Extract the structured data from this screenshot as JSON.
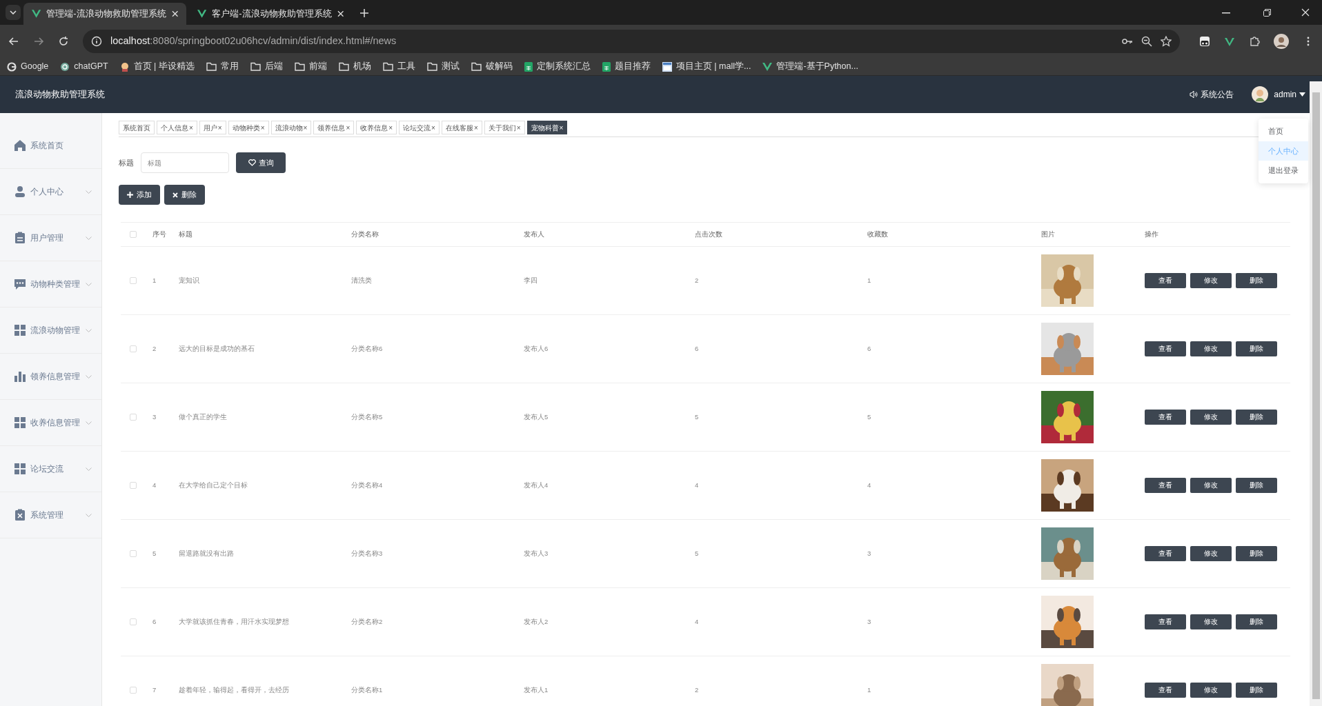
{
  "browser": {
    "tabs": [
      {
        "title": "管理端-流浪动物救助管理系统",
        "selected": true
      },
      {
        "title": "客户端-流浪动物救助管理系统",
        "selected": false
      }
    ],
    "url_host": "localhost",
    "url_rest": ":8080/springboot02u06hcv/admin/dist/index.html#/news",
    "bookmarks": [
      {
        "label": "Google",
        "kind": "google"
      },
      {
        "label": "chatGPT",
        "kind": "site"
      },
      {
        "label": "首页 | 毕设精选",
        "kind": "avatar"
      },
      {
        "label": "常用",
        "kind": "folder"
      },
      {
        "label": "后端",
        "kind": "folder"
      },
      {
        "label": "前端",
        "kind": "folder"
      },
      {
        "label": "机场",
        "kind": "folder"
      },
      {
        "label": "工具",
        "kind": "folder"
      },
      {
        "label": "测试",
        "kind": "folder"
      },
      {
        "label": "破解码",
        "kind": "folder"
      },
      {
        "label": "定制系统汇总",
        "kind": "sheet"
      },
      {
        "label": "题目推荐",
        "kind": "sheet"
      },
      {
        "label": "项目主页 | mall学...",
        "kind": "page"
      },
      {
        "label": "管理端-基于Python...",
        "kind": "vue"
      }
    ]
  },
  "app": {
    "title": "流浪动物救助管理系统",
    "notice": "系统公告",
    "user": "admin",
    "user_menu": [
      {
        "label": "首页",
        "selected": false
      },
      {
        "label": "个人中心",
        "selected": true
      },
      {
        "label": "退出登录",
        "selected": false
      }
    ]
  },
  "sidebar": {
    "items": [
      {
        "label": "系统首页",
        "kind": "home",
        "expandable": false
      },
      {
        "label": "个人中心",
        "kind": "user",
        "expandable": true
      },
      {
        "label": "用户管理",
        "kind": "clipboard",
        "expandable": true
      },
      {
        "label": "动物种类管理",
        "kind": "chat",
        "expandable": true
      },
      {
        "label": "流浪动物管理",
        "kind": "grid",
        "expandable": true
      },
      {
        "label": "领养信息管理",
        "kind": "bars",
        "expandable": true
      },
      {
        "label": "收养信息管理",
        "kind": "grid",
        "expandable": true
      },
      {
        "label": "论坛交流",
        "kind": "grid",
        "expandable": true
      },
      {
        "label": "系统管理",
        "kind": "clipboardx",
        "expandable": true
      }
    ]
  },
  "tags": [
    {
      "label": "系统首页",
      "selected": false
    },
    {
      "label": "个人信息",
      "close": "×",
      "selected": false
    },
    {
      "label": "用户",
      "close": "×",
      "selected": false
    },
    {
      "label": "动物种类",
      "close": "×",
      "selected": false
    },
    {
      "label": "流浪动物",
      "close": "×",
      "selected": false
    },
    {
      "label": "领养信息",
      "close": "×",
      "selected": false
    },
    {
      "label": "收养信息",
      "close": "×",
      "selected": false
    },
    {
      "label": "论坛交流",
      "close": "×",
      "selected": false
    },
    {
      "label": "在线客服",
      "close": "×",
      "selected": false
    },
    {
      "label": "关于我们",
      "close": "×",
      "selected": false
    },
    {
      "label": "宠物科普",
      "close": "×",
      "selected": true
    }
  ],
  "search": {
    "label": "标题",
    "placeholder": "标题",
    "button": "查询"
  },
  "actions": [
    {
      "label": "添加",
      "kind": "add"
    },
    {
      "label": "删除",
      "kind": "delete"
    }
  ],
  "table": {
    "header_checked": false,
    "columns": [
      "序号",
      "标题",
      "分类名称",
      "发布人",
      "点击次数",
      "收藏数",
      "图片",
      "操作"
    ],
    "rows": [
      {
        "checked": false,
        "cells": [
          "1",
          "宠知识",
          "清洗类",
          "李四",
          "2",
          "1"
        ],
        "actions": [
          "查看",
          "修改",
          "删除"
        ]
      },
      {
        "checked": false,
        "cells": [
          "2",
          "远大的目标是成功的基石",
          "分类名称6",
          "发布人6",
          "6",
          "6"
        ],
        "actions": [
          "查看",
          "修改",
          "删除"
        ]
      },
      {
        "checked": false,
        "cells": [
          "3",
          "做个真正的学生",
          "分类名称5",
          "发布人5",
          "5",
          "5"
        ],
        "actions": [
          "查看",
          "修改",
          "删除"
        ]
      },
      {
        "checked": false,
        "cells": [
          "4",
          "在大学给自己定个目标",
          "分类名称4",
          "发布人4",
          "4",
          "4"
        ],
        "actions": [
          "查看",
          "修改",
          "删除"
        ]
      },
      {
        "checked": false,
        "cells": [
          "5",
          "留退路就没有出路",
          "分类名称3",
          "发布人3",
          "5",
          "3"
        ],
        "actions": [
          "查看",
          "修改",
          "删除"
        ]
      },
      {
        "checked": false,
        "cells": [
          "6",
          "大学就该抓住青春，用汗水实现梦想",
          "分类名称2",
          "发布人2",
          "4",
          "3"
        ],
        "actions": [
          "查看",
          "修改",
          "删除"
        ]
      },
      {
        "checked": false,
        "cells": [
          "7",
          "趁着年轻，输得起，看得开，去经历",
          "分类名称1",
          "发布人1",
          "2",
          "1"
        ],
        "actions": [
          "查看",
          "修改",
          "删除"
        ]
      }
    ]
  }
}
